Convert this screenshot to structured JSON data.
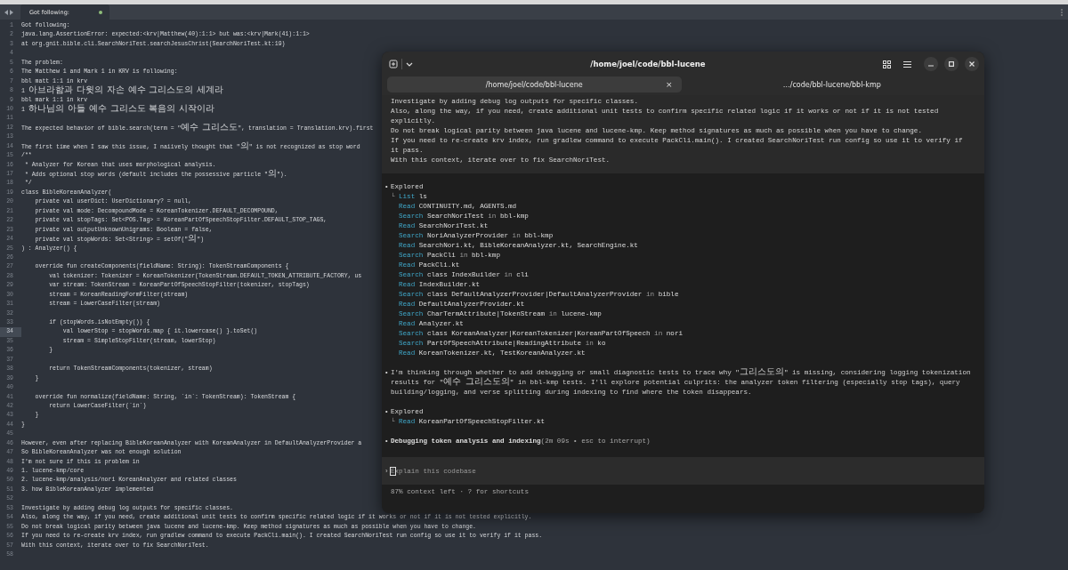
{
  "editor": {
    "tab": {
      "title": "Got following:",
      "modified": true
    },
    "lines": [
      {
        "number": "1",
        "text": "Got following:",
        "current": false
      },
      {
        "number": "2",
        "text": "java.lang.AssertionError: expected:<krv|Matthew(40):1:1> but was:<krv|Mark(41):1:1>",
        "current": false
      },
      {
        "number": "3",
        "text": "at org.gnit.bible.cli.SearchNoriTest.searchJesusChrist(SearchNoriTest.kt:19)",
        "current": false
      },
      {
        "number": "4",
        "current": false
      },
      {
        "number": "5",
        "text": "The problem:",
        "current": false
      },
      {
        "number": "6",
        "text": "The Matthew 1 and Mark 1 in KRV is following:",
        "current": false
      },
      {
        "number": "7",
        "text": "bbl matt 1:1 in krv",
        "current": false
      },
      {
        "number": "8",
        "text": "1 아브라함과 다윗의 자손 예수 그리스도의 세계라",
        "current": false
      },
      {
        "number": "9",
        "text": "bbl mark 1:1 in krv",
        "current": false
      },
      {
        "number": "10",
        "text": "1 하나님의 아들 예수 그리스도 복음의 시작이라",
        "current": false
      },
      {
        "number": "11",
        "current": false
      },
      {
        "number": "12",
        "text": "The expected behavior of bible.search(term = \"예수 그리스도\", translation = Translation.krv).first",
        "current": false
      },
      {
        "number": "13",
        "current": false
      },
      {
        "number": "14",
        "text": "The first time when I saw this issue, I naiively thought that \"의\" is not recognized as stop word",
        "current": false
      },
      {
        "number": "15",
        "text": "/**",
        "current": false
      },
      {
        "number": "16",
        "text": " * Analyzer for Korean that uses morphological analysis.",
        "current": false
      },
      {
        "number": "17",
        "text": " * Adds optional stop words (default includes the possessive particle \"의\").",
        "current": false
      },
      {
        "number": "18",
        "text": " */",
        "current": false
      },
      {
        "number": "19",
        "text": "class BibleKoreanAnalyzer(",
        "current": false
      },
      {
        "number": "20",
        "text": "    private val userDict: UserDictionary? = null,",
        "current": false
      },
      {
        "number": "21",
        "text": "    private val mode: DecompoundMode = KoreanTokenizer.DEFAULT_DECOMPOUND,",
        "current": false
      },
      {
        "number": "22",
        "text": "    private val stopTags: Set<POS.Tag> = KoreanPartOfSpeechStopFilter.DEFAULT_STOP_TAGS,",
        "current": false
      },
      {
        "number": "23",
        "text": "    private val outputUnknownUnigrams: Boolean = false,",
        "current": false
      },
      {
        "number": "24",
        "text": "    private val stopWords: Set<String> = setOf(\"의\")",
        "current": false
      },
      {
        "number": "25",
        "text": ") : Analyzer() {",
        "current": false
      },
      {
        "number": "26",
        "current": false
      },
      {
        "number": "27",
        "text": "    override fun createComponents(fieldName: String): TokenStreamComponents {",
        "current": false
      },
      {
        "number": "28",
        "text": "        val tokenizer: Tokenizer = KoreanTokenizer(TokenStream.DEFAULT_TOKEN_ATTRIBUTE_FACTORY, us",
        "current": false
      },
      {
        "number": "29",
        "text": "        var stream: TokenStream = KoreanPartOfSpeechStopFilter(tokenizer, stopTags)",
        "current": false
      },
      {
        "number": "30",
        "text": "        stream = KoreanReadingFormFilter(stream)",
        "current": false
      },
      {
        "number": "31",
        "text": "        stream = LowerCaseFilter(stream)",
        "current": false
      },
      {
        "number": "32",
        "current": false
      },
      {
        "number": "33",
        "text": "        if (stopWords.isNotEmpty()) {",
        "current": false
      },
      {
        "number": "34",
        "text": "            val lowerStop = stopWords.map { it.lowercase() }.toSet()",
        "current": true
      },
      {
        "number": "35",
        "text": "            stream = SimpleStopFilter(stream, lowerStop)",
        "current": false
      },
      {
        "number": "36",
        "text": "        }",
        "current": false
      },
      {
        "number": "37",
        "current": false
      },
      {
        "number": "38",
        "text": "        return TokenStreamComponents(tokenizer, stream)",
        "current": false
      },
      {
        "number": "39",
        "text": "    }",
        "current": false
      },
      {
        "number": "40",
        "current": false
      },
      {
        "number": "41",
        "text": "    override fun normalize(fieldName: String, `in`: TokenStream): TokenStream {",
        "current": false
      },
      {
        "number": "42",
        "text": "        return LowerCaseFilter(`in`)",
        "current": false
      },
      {
        "number": "43",
        "text": "    }",
        "current": false
      },
      {
        "number": "44",
        "text": "}",
        "current": false
      },
      {
        "number": "45",
        "current": false
      },
      {
        "number": "46",
        "text": "However, even after replacing BibleKoreanAnalyzer with KoreanAnalyzer in DefaultAnalyzerProvider a",
        "current": false
      },
      {
        "number": "47",
        "text": "So BibleKoreanAnalyzer was not enough solution",
        "current": false
      },
      {
        "number": "48",
        "text": "I'm not sure if this is problem in",
        "current": false
      },
      {
        "number": "49",
        "text": "1. lucene-kmp/core",
        "current": false
      },
      {
        "number": "50",
        "text": "2. lucene-kmp/analysis/nori KoreanAnalyzer and related classes",
        "current": false
      },
      {
        "number": "51",
        "text": "3. how BibleKoreanAnalyzer implemented",
        "current": false
      },
      {
        "number": "52",
        "current": false
      },
      {
        "number": "53",
        "text": "Investigate by adding debug log outputs for specific classes.",
        "current": false
      },
      {
        "number": "54",
        "text": "Also, along the way, if you need, create additional unit tests to confirm specific related logic if it works or not if it is not tested explicitly.",
        "current": false
      },
      {
        "number": "55",
        "text": "Do not break logical parity between java lucene and lucene-kmp. Keep method signatures as much as possible when you have to change.",
        "current": false
      },
      {
        "number": "56",
        "text": "If you need to re-create krv index, run gradlew command to execute PackCli.main(). I created SearchNoriTest run config so use it to verify if it pass.",
        "current": false
      },
      {
        "number": "57",
        "text": "With this context, iterate over to fix SearchNoriTest.",
        "current": false
      },
      {
        "number": "58",
        "current": false
      }
    ]
  },
  "terminal": {
    "title": "/home/joel/code/bbl-lucene",
    "tabs": [
      {
        "label": "/home/joel/code/bbl-lucene",
        "selected": true,
        "close": "×"
      },
      {
        "label": "…/code/bbl-lucene/bbl-kmp",
        "selected": false
      }
    ],
    "prompt_block": [
      "Investigate by adding debug log outputs for specific classes.",
      "Also, along the way, if you need, create additional unit tests to confirm specific related logic if it works or not if it is not tested",
      "explicitly.",
      "Do not break logical parity between java lucene and lucene-kmp. Keep method signatures as much as possible when you have to change.",
      "If you need to re-create krv index, run gradlew command to execute PackCli.main(). I created SearchNoriTest run config so use it to verify if",
      "it pass.",
      "With this context, iterate over to fix SearchNoriTest."
    ],
    "entries": [
      {
        "kind": "explored",
        "bullet": "•",
        "title": "Explored",
        "branch": "└",
        "items": [
          {
            "action": "List",
            "subject": "ls"
          },
          {
            "action": "Read",
            "subject": "CONTINUITY.md, AGENTS.md"
          },
          {
            "action": "Search",
            "subject": "SearchNoriTest",
            "preposition": "in",
            "scope": "bbl-kmp"
          },
          {
            "action": "Read",
            "subject": "SearchNoriTest.kt"
          },
          {
            "action": "Search",
            "subject": "NoriAnalyzerProvider",
            "preposition": "in",
            "scope": "bbl-kmp"
          },
          {
            "action": "Read",
            "subject": "SearchNori.kt, BibleKoreanAnalyzer.kt, SearchEngine.kt"
          },
          {
            "action": "Search",
            "subject": "PackCli",
            "preposition": "in",
            "scope": "bbl-kmp"
          },
          {
            "action": "Read",
            "subject": "PackCli.kt"
          },
          {
            "action": "Search",
            "subject": "class IndexBuilder",
            "preposition": "in",
            "scope": "cli"
          },
          {
            "action": "Read",
            "subject": "IndexBuilder.kt"
          },
          {
            "action": "Search",
            "subject": "class DefaultAnalyzerProvider|DefaultAnalyzerProvider",
            "preposition": "in",
            "scope": "bible"
          },
          {
            "action": "Read",
            "subject": "DefaultAnalyzerProvider.kt"
          },
          {
            "action": "Search",
            "subject": "CharTermAttribute|TokenStream",
            "preposition": "in",
            "scope": "lucene-kmp"
          },
          {
            "action": "Read",
            "subject": "Analyzer.kt"
          },
          {
            "action": "Search",
            "subject": "class KoreanAnalyzer|KoreanTokenizer|KoreanPartOfSpeech",
            "preposition": "in",
            "scope": "nori"
          },
          {
            "action": "Search",
            "subject": "PartOfSpeechAttribute|ReadingAttribute",
            "preposition": "in",
            "scope": "ko"
          },
          {
            "action": "Read",
            "subject": "KoreanTokenizer.kt, TestKoreanAnalyzer.kt"
          }
        ]
      },
      {
        "kind": "message",
        "bullet": "•",
        "text": "I'm thinking through whether to add debugging or small diagnostic tests to trace why \"그리스도의\" is missing, considering logging tokenization results for \"예수 그리스도의\" in bbl-kmp tests. I'll explore potential culprits: the analyzer token filtering (especially stop tags), query building/logging, and verse splitting during indexing to find where the token disappears."
      },
      {
        "kind": "explored",
        "bullet": "•",
        "title": "Explored",
        "branch": "└",
        "items": [
          {
            "action": "Read",
            "subject": "KoreanPartOfSpeechStopFilter.kt"
          }
        ]
      },
      {
        "kind": "status",
        "bullet": "•",
        "text": "Debugging token analysis and indexing",
        "detail": "(2m 09s • esc to interrupt)"
      }
    ],
    "input": {
      "prompt": "›",
      "placeholder": "Explain this codebase"
    },
    "footer": "87% context left · ? for shortcuts"
  }
}
